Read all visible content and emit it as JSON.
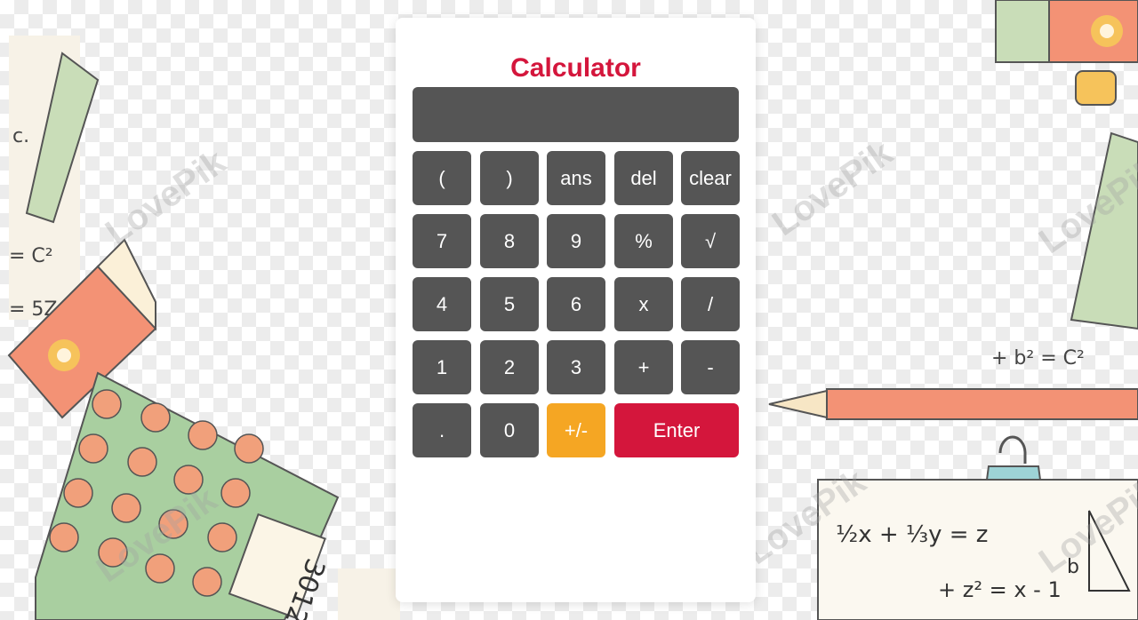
{
  "app": {
    "title": "Calculator"
  },
  "display": {
    "value": ""
  },
  "keys": {
    "open_paren": "(",
    "close_paren": ")",
    "ans": "ans",
    "del": "del",
    "clear": "clear",
    "seven": "7",
    "eight": "8",
    "nine": "9",
    "percent": "%",
    "sqrt": "√",
    "four": "4",
    "five": "5",
    "six": "6",
    "multiply": "x",
    "divide": "/",
    "one": "1",
    "two": "2",
    "three": "3",
    "plus": "+",
    "minus": "-",
    "dot": ".",
    "zero": "0",
    "sign": "+/-",
    "enter": "Enter"
  },
  "background": {
    "calculator_art_digits": "3012",
    "equations": [
      "1/2 x + 1/3 y = z",
      "+ z² = x - 1",
      "= c²",
      "= 52",
      "+ b² = c²"
    ]
  },
  "colors": {
    "accent": "#d4163c",
    "key_bg": "#555555",
    "sign_key": "#f5a623",
    "card": "#ffffff"
  }
}
